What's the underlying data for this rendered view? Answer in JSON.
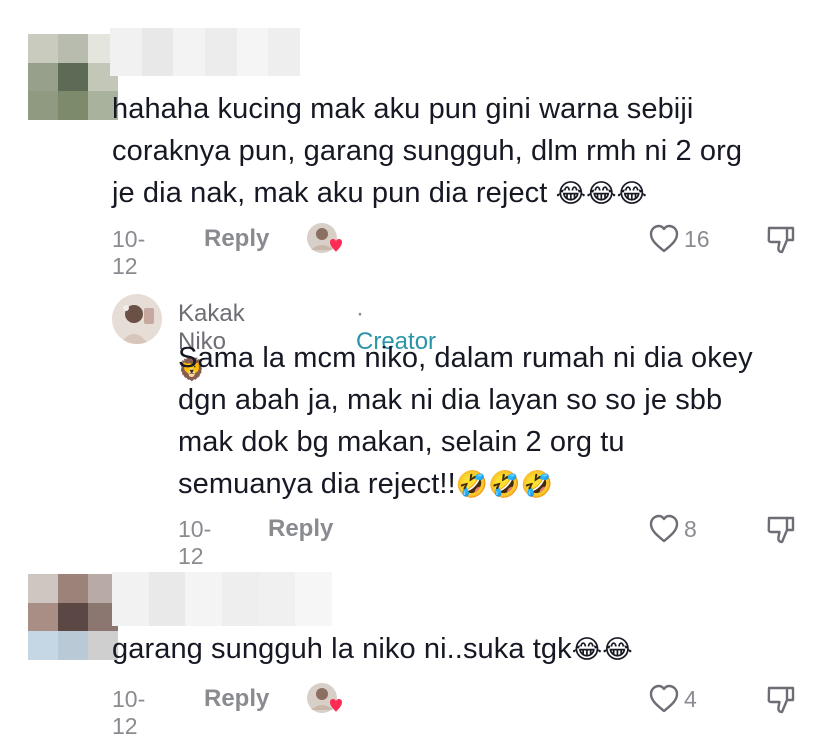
{
  "comments": [
    {
      "lines": [
        "hahaha kucing mak aku pun gini warna sebiji",
        "coraknya pun, garang sungguh, dlm rmh ni 2 org",
        "je dia nak, mak aku pun dia reject"
      ],
      "emojis": "😂😂😂",
      "date": "10-12",
      "reply_label": "Reply",
      "likes": "16",
      "avatar_colors": [
        "#c8cbbd",
        "#b7bcae",
        "#e4e6de",
        "#97a08a",
        "#5d6b56",
        "#c2c7b8",
        "#8f9a80",
        "#7d8a6c",
        "#a9b29c"
      ],
      "name_colors": [
        "#f1f1f1",
        "#e8e8e8",
        "#f3f3f3",
        "#ececec",
        "#f5f5f5",
        "#eeeeee"
      ]
    },
    {
      "author": "Kakak Niko",
      "author_emoji": "🦁",
      "tag_separator": "·",
      "tag": "Creator",
      "lines": [
        "Sama la mcm niko, dalam rumah ni dia okey",
        "dgn abah ja, mak ni dia layan so so je sbb",
        "mak dok bg makan, selain 2 org tu",
        "semuanya dia reject!!"
      ],
      "emojis": "🤣🤣🤣",
      "date": "10-12",
      "reply_label": "Reply",
      "likes": "8"
    },
    {
      "lines": [
        "garang sungguh la niko ni..suka tgk"
      ],
      "emojis": "😂😂",
      "date": "10-12",
      "reply_label": "Reply",
      "likes": "4",
      "avatar_colors": [
        "#cfc6c2",
        "#9b837a",
        "#b8aaa4",
        "#a88e84",
        "#5b4844",
        "#8c7770",
        "#c5d6e4",
        "#b9c9d6",
        "#cfcfcf"
      ],
      "name_colors": [
        "#f2f2f2",
        "#e9e9e9",
        "#f4f4f4",
        "#eeeeee",
        "#f0f0f0",
        "#f6f6f6"
      ]
    }
  ],
  "icons": {
    "heart": "heart-icon",
    "dislike": "dislike-icon",
    "creator_liked": "creator-liked-avatar-icon"
  },
  "colors": {
    "text": "#161823",
    "muted": "#8a8b91",
    "creator_tag": "#2a94a8",
    "heart_badge": "#fe2c55"
  }
}
